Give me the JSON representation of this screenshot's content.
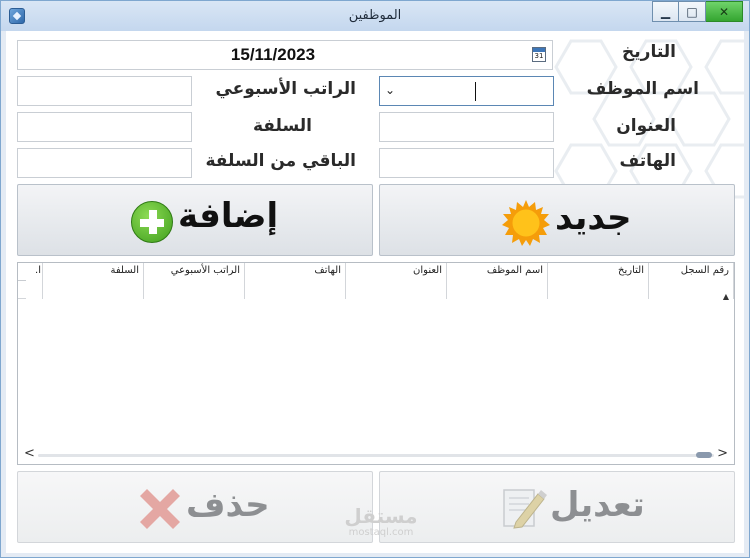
{
  "window": {
    "title": "الموظفين",
    "controls": {
      "minimize": "▭",
      "maximize": "□",
      "close": "✕"
    }
  },
  "form": {
    "date_label": "التاريخ",
    "date_value": "15/11/2023",
    "calendar_day": "31",
    "employee_name_label": "اسم الموظف",
    "combo_arrow": "⌄",
    "weekly_salary_label": "الراتب الأسبوعي",
    "address_label": "العنوان",
    "advance_label": "السلفة",
    "phone_label": "الهاتف",
    "remaining_advance_label": "الباقي من السلفة"
  },
  "buttons": {
    "new_label": "جديد",
    "add_label": "إضافة",
    "edit_label": "تعديل",
    "delete_label": "حذف"
  },
  "table": {
    "columns": [
      "رقم السجل",
      "التاريخ",
      "اسم الموظف",
      "العنوان",
      "الهاتف",
      "الراتب الأسبوعي",
      "السلفة",
      "ا."
    ],
    "scroll_up": "▲",
    "scroll_left": "<",
    "scroll_right": ">"
  },
  "watermark": {
    "text": "مستقل",
    "sub": "mostaql.com"
  },
  "colors": {
    "accent_green": "#3f9e1c",
    "sun_orange": "#f5a40c",
    "delete_red": "#d9534f",
    "frame_blue": "#7fa7cf"
  }
}
